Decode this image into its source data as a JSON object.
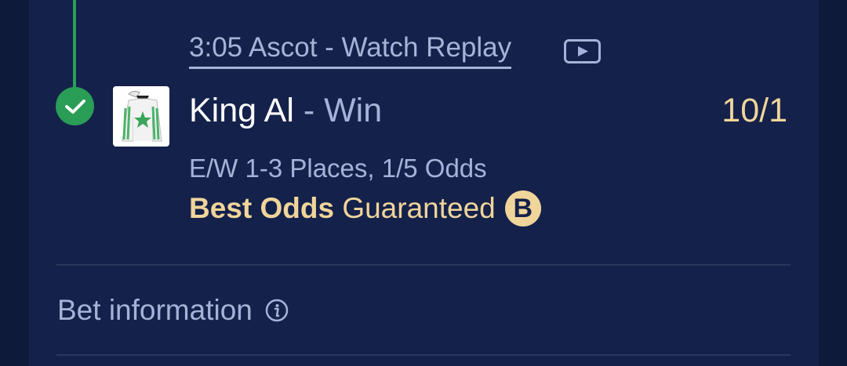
{
  "race": {
    "link_text": "3:05 Ascot - Watch Replay",
    "replay_icon": "play-video-icon"
  },
  "selection": {
    "horse": "King Al",
    "separator": " - ",
    "market": "Win",
    "odds": "10/1",
    "status_icon": "checkmark-icon",
    "silk_icon": "jockey-silk-icon"
  },
  "terms": {
    "each_way": "E/W 1-3 Places, 1/5 Odds",
    "bog_bold": "Best Odds",
    "bog_rest": " Guaranteed",
    "bog_badge": "B"
  },
  "bet_info": {
    "label": "Bet information",
    "icon": "info-icon"
  },
  "colors": {
    "background": "#0e1a3a",
    "card": "#14214a",
    "accent_green": "#2a9d57",
    "gold": "#f0d59b",
    "muted_text": "#a6b3d8"
  }
}
